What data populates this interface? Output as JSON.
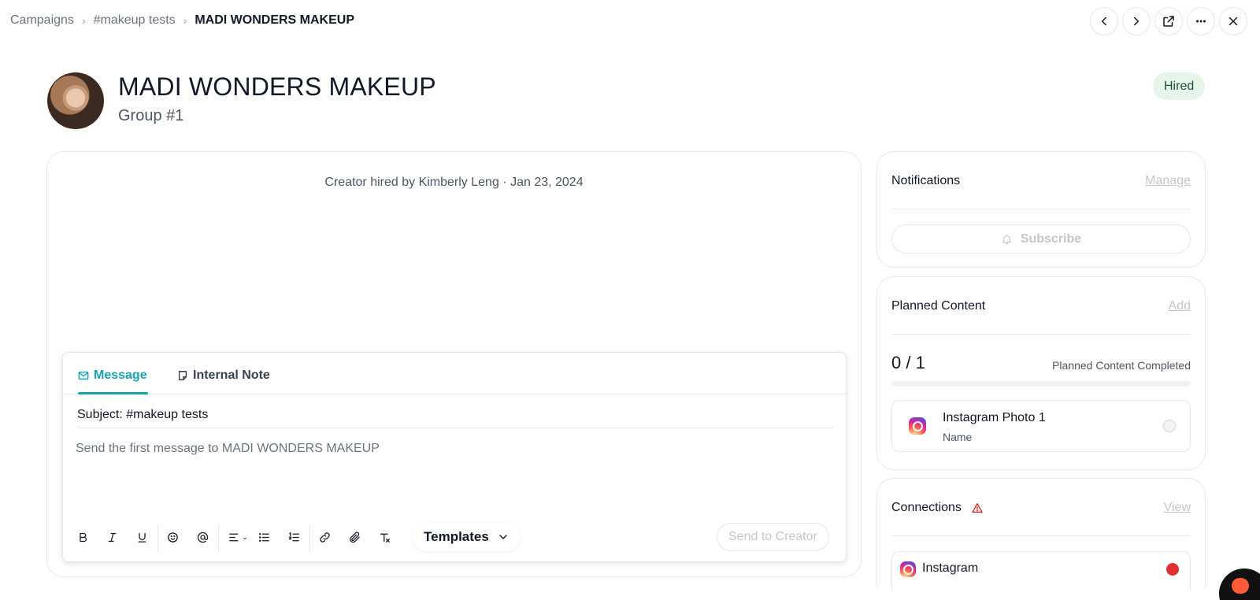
{
  "breadcrumb": {
    "items": [
      "Campaigns",
      "#makeup tests"
    ],
    "current": "MADI WONDERS MAKEUP"
  },
  "topbar_actions": [
    "chevron-left-icon",
    "chevron-right-icon",
    "external-link-icon",
    "more-icon",
    "close-icon"
  ],
  "header": {
    "title": "MADI WONDERS MAKEUP",
    "subtitle": "Group #1",
    "status": "Hired",
    "status_color": "#e6f4ea"
  },
  "activity": {
    "text": "Creator hired by Kimberly Leng",
    "date": "· Jan 23, 2024"
  },
  "composer": {
    "tabs": [
      {
        "label": "Message",
        "icon": "mail-icon",
        "active": true
      },
      {
        "label": "Internal Note",
        "icon": "note-icon",
        "active": false
      }
    ],
    "subject": "Subject: #makeup tests",
    "placeholder": "Send the first message to MADI WONDERS MAKEUP",
    "templates_label": "Templates",
    "send_label": "Send to Creator",
    "accent": "#17a2b8"
  },
  "notifications": {
    "title": "Notifications",
    "link": "Manage",
    "subscribe_label": "Subscribe"
  },
  "planned_content": {
    "title": "Planned Content",
    "link": "Add",
    "count": "0 / 1",
    "completed_label": "Planned Content Completed",
    "progress_fraction": 0,
    "items": [
      {
        "title": "Instagram Photo 1",
        "subtitle": "Name",
        "icon": "instagram-icon"
      }
    ]
  },
  "connections": {
    "title": "Connections",
    "link": "View",
    "items": [
      {
        "label": "Instagram",
        "icon": "instagram-icon",
        "status_color": "#e03131"
      }
    ]
  }
}
